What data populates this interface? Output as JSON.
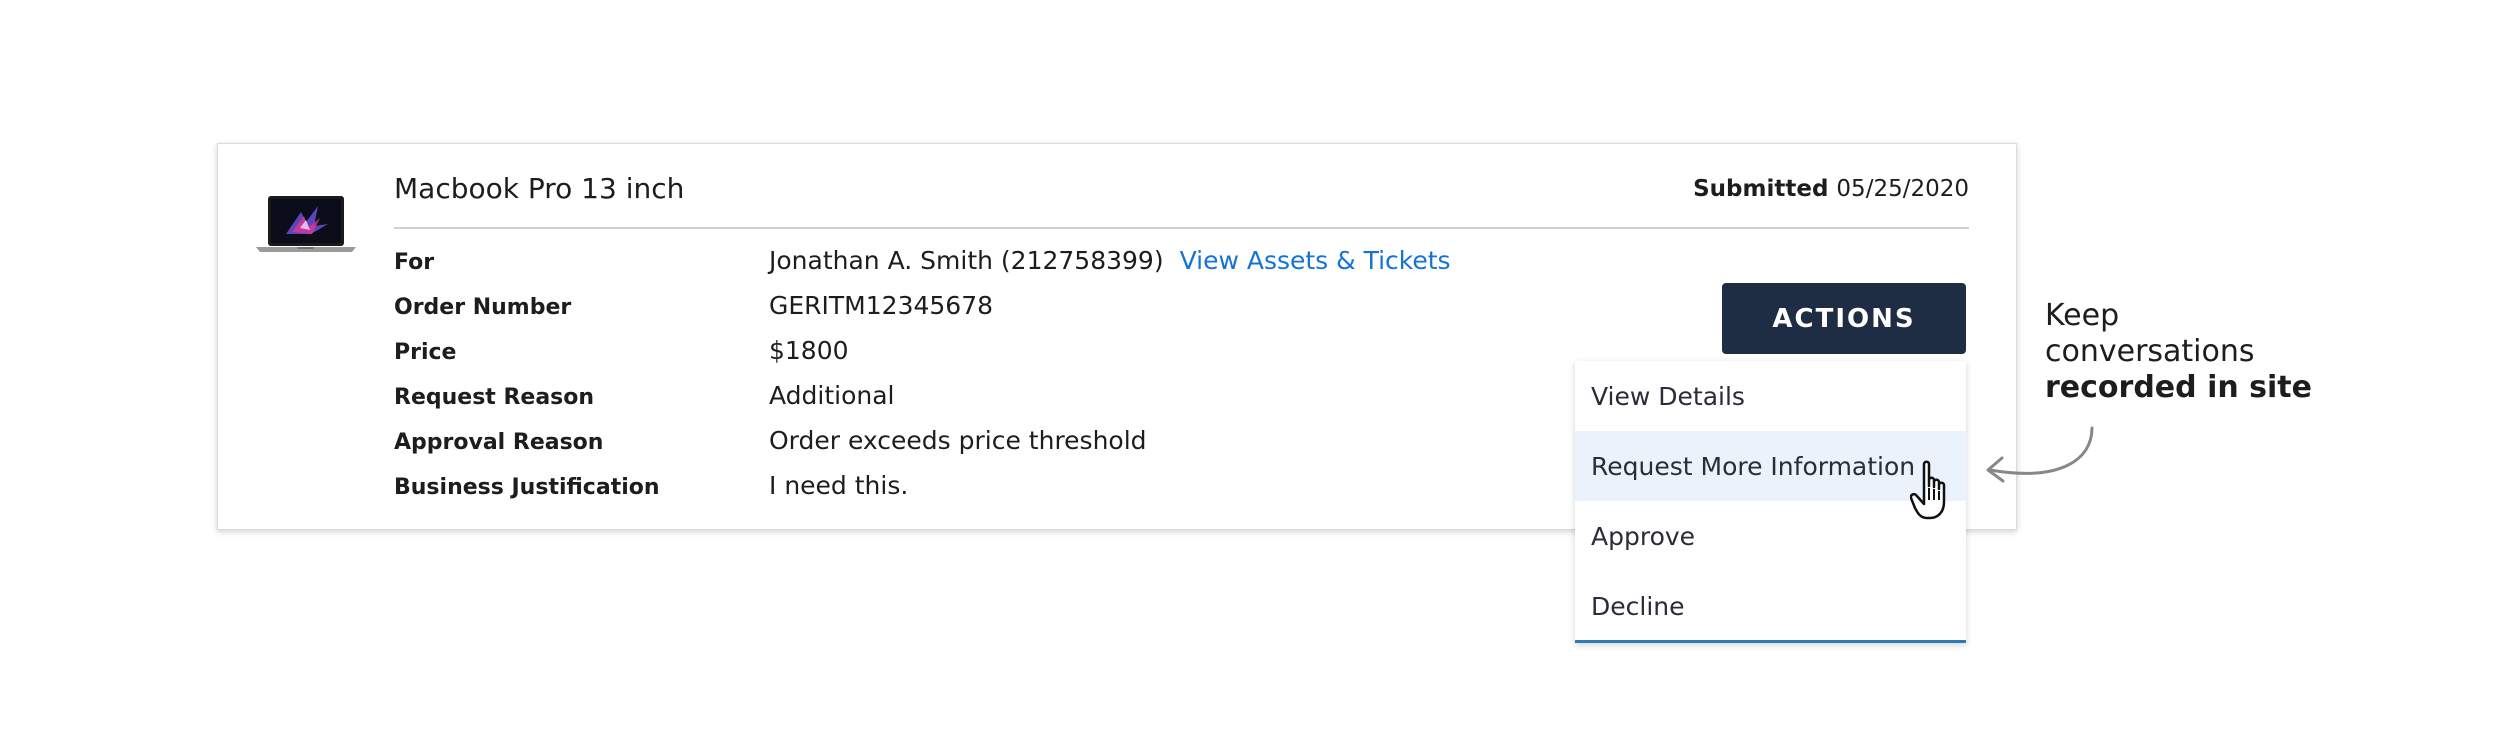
{
  "product": {
    "title": "Macbook Pro 13 inch",
    "image": "laptop-thumbnail"
  },
  "submitted": {
    "label": "Submitted",
    "date": "05/25/2020"
  },
  "details": {
    "for_label": "For",
    "for_value": "Jonathan A. Smith (212758399)",
    "for_link": "View Assets & Tickets",
    "order_label": "Order Number",
    "order_value": "GERITM12345678",
    "price_label": "Price",
    "price_value": "$1800",
    "request_reason_label": "Request Reason",
    "request_reason_value": "Additional",
    "approval_reason_label": "Approval Reason",
    "approval_reason_value": "Order exceeds price threshold",
    "justification_label": "Business Justification",
    "justification_value": "I need this."
  },
  "actions": {
    "button_label": "ACTIONS",
    "menu": [
      {
        "label": "View Details"
      },
      {
        "label": "Request More Information"
      },
      {
        "label": "Approve"
      },
      {
        "label": "Decline"
      }
    ],
    "highlighted_item": "Request More Information"
  },
  "annotation": {
    "line1": "Keep",
    "line2": "conversations",
    "line3": "recorded in site"
  },
  "icons": {
    "cursor": "hand-pointer-icon",
    "arrow": "curved-arrow-icon"
  },
  "colors": {
    "button_bg": "#1f2d44",
    "link": "#1474d4",
    "menu_highlight": "#eaf3fc",
    "menu_underline": "#2f79b5"
  }
}
